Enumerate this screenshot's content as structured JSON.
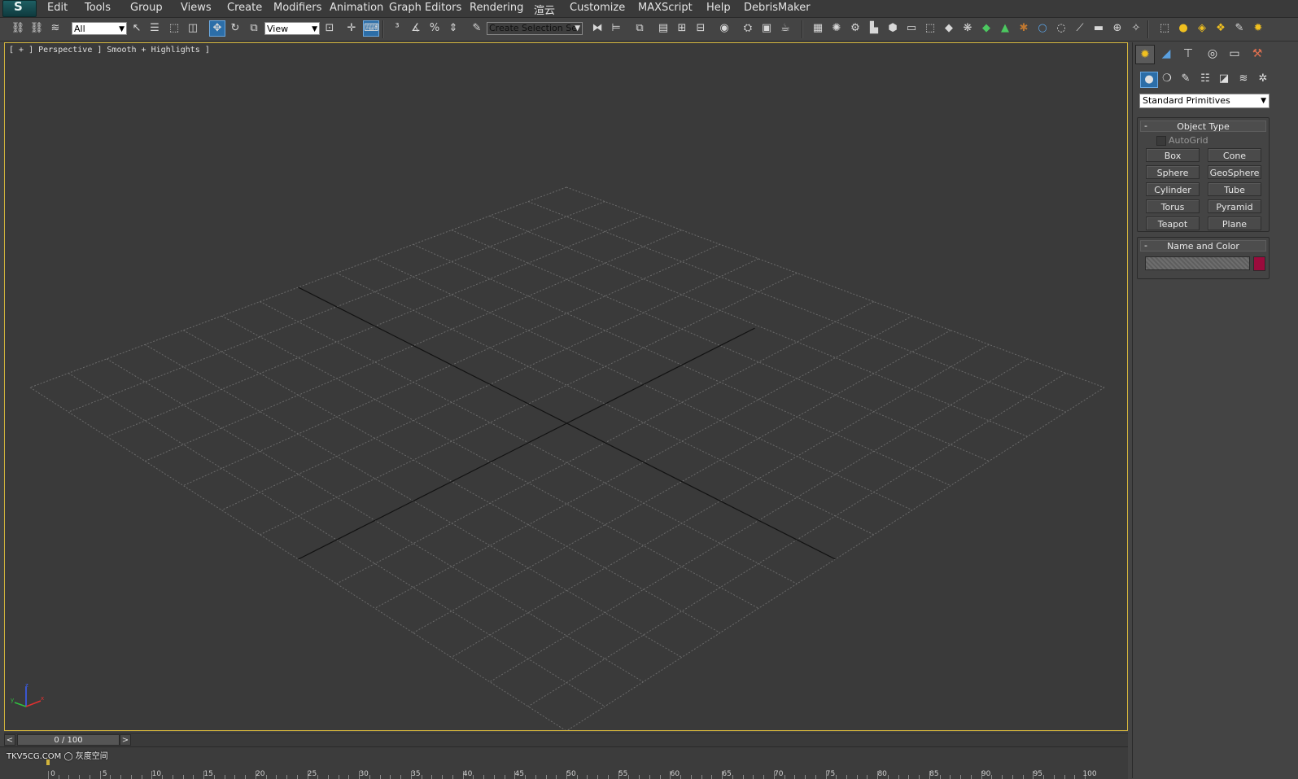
{
  "app": {
    "logo": "S"
  },
  "menu": [
    "Edit",
    "Tools",
    "Group",
    "Views",
    "Create",
    "Modifiers",
    "Animation",
    "Graph Editors",
    "Rendering",
    "渲云",
    "Customize",
    "MAXScript",
    "Help",
    "DebrisMaker"
  ],
  "toolbar": {
    "selection_filter": "All",
    "reference_coord": "View",
    "named_selection_placeholder": "Create Selection Se"
  },
  "viewport": {
    "label": "[ + ] Perspective ] Smooth + Highlights ]",
    "axis": {
      "x": "x",
      "y": "y",
      "z": "z"
    }
  },
  "command_panel": {
    "category_dropdown": "Standard Primitives",
    "object_type": {
      "title": "Object Type",
      "collapse": "-",
      "autogrid": "AutoGrid",
      "buttons": [
        "Box",
        "Cone",
        "Sphere",
        "GeoSphere",
        "Cylinder",
        "Tube",
        "Torus",
        "Pyramid",
        "Teapot",
        "Plane"
      ]
    },
    "name_and_color": {
      "title": "Name and Color",
      "collapse": "-",
      "swatch_color": "#9a0b3c"
    }
  },
  "time_slider": {
    "label": "0 / 100",
    "prev": "<",
    "next": ">"
  },
  "track_bar": {
    "ticks": [
      "0",
      "5",
      "10",
      "15",
      "20",
      "25",
      "30",
      "35",
      "40",
      "45",
      "50",
      "55",
      "60",
      "65",
      "70",
      "75",
      "80",
      "85",
      "90",
      "95",
      "100"
    ]
  },
  "watermark": "TKV5CG.COM ◯ 灰度空间",
  "colors": {
    "viewport_border": "#d2b43c",
    "active_tool": "#2c6ea8"
  }
}
